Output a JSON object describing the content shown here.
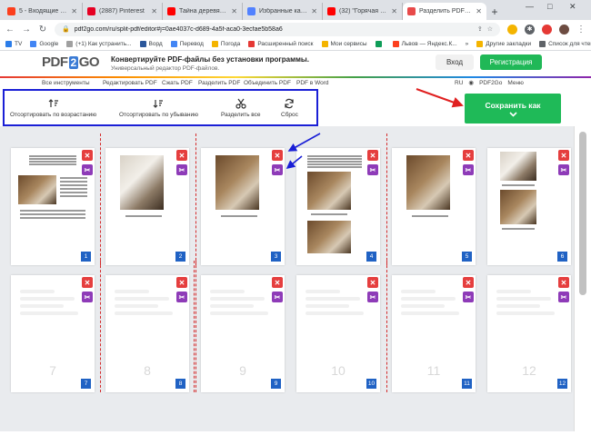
{
  "browser": {
    "tabs": [
      {
        "label": "5 - Входящие — Янд",
        "color": "#fc3f1d",
        "active": false
      },
      {
        "label": "(2887) Pinterest",
        "color": "#e60023",
        "active": false
      },
      {
        "label": "Тайна деревянных ид",
        "color": "#ff0000",
        "active": false
      },
      {
        "label": "Избранные каналы — ",
        "color": "#5282ff",
        "active": false
      },
      {
        "label": "(32) \"Горячая точка\" 1",
        "color": "#ff0000",
        "active": false
      },
      {
        "label": "Разделить PDF — Разд",
        "color": "#e84a4a",
        "active": true
      }
    ],
    "new_tab": "+",
    "window_controls": {
      "min": "—",
      "max": "□",
      "close": "✕"
    },
    "url": "pdf2go.com/ru/split-pdf/editor#j=0ae4037c-d689-4a5f-aca0-3ecfae5b58a6",
    "bookmarks": [
      {
        "label": "TV",
        "color": "#2b7de9"
      },
      {
        "label": "Google",
        "color": "#4285f4"
      },
      {
        "label": "(+1) Как устранить...",
        "color": "#a0a0a0"
      },
      {
        "label": "Ворд",
        "color": "#2b579a"
      },
      {
        "label": "Перевод",
        "color": "#4285f4"
      },
      {
        "label": "Погода",
        "color": "#f4b400"
      },
      {
        "label": "Расширенный поиск",
        "color": "#e53935"
      },
      {
        "label": "Мои сервисы",
        "color": "#f4b400"
      },
      {
        "label": "",
        "color": "#0f9d58"
      },
      {
        "label": "Львов — Яндекс.К...",
        "color": "#fc3f1d"
      },
      {
        "label": "Другие закладки",
        "color": "#f4b400"
      },
      {
        "label": "Список для чтения",
        "color": "#5f6368"
      }
    ],
    "bookmarks_more": "»"
  },
  "site": {
    "logo_left": "PDF",
    "logo_mid": "2",
    "logo_right": "GO",
    "tagline_title": "Конвертируйте PDF-файлы без установки программы.",
    "tagline_sub": "Универсальный редактор PDF-файлов.",
    "login": "Вход",
    "register": "Регистрация",
    "menu_items": [
      "Все инструменты",
      "Редактировать PDF",
      "Сжать PDF",
      "Разделить PDF",
      "Объединить PDF",
      "PDF в Word"
    ],
    "lang": "RU",
    "brand_small": "PDF2Go",
    "menu": "Меню"
  },
  "toolbar": {
    "sort_asc": "Отсортировать по возрастанию",
    "sort_desc": "Отсортировать по убыванию",
    "split_all": "Разделить все",
    "reset": "Сброс"
  },
  "save": {
    "label": "Сохранить как"
  },
  "pages": [
    {
      "num": "1",
      "kind": "doc"
    },
    {
      "num": "2",
      "kind": "photo"
    },
    {
      "num": "3",
      "kind": "photo"
    },
    {
      "num": "4",
      "kind": "doc2"
    },
    {
      "num": "5",
      "kind": "photo"
    },
    {
      "num": "6",
      "kind": "photos"
    },
    {
      "num": "7",
      "kind": "placeholder"
    },
    {
      "num": "8",
      "kind": "placeholder"
    },
    {
      "num": "9",
      "kind": "placeholder"
    },
    {
      "num": "10",
      "kind": "placeholder"
    },
    {
      "num": "11",
      "kind": "placeholder"
    },
    {
      "num": "12",
      "kind": "placeholder"
    }
  ],
  "icons": {
    "delete": "✕",
    "split": "✂"
  },
  "colors": {
    "accent_green": "#1fba58",
    "page_badge": "#2062c4",
    "delete_btn": "#e53e3e",
    "split_btn": "#8e3bb8",
    "annotation_blue": "#1a1fd6",
    "annotation_red": "#e02020"
  }
}
